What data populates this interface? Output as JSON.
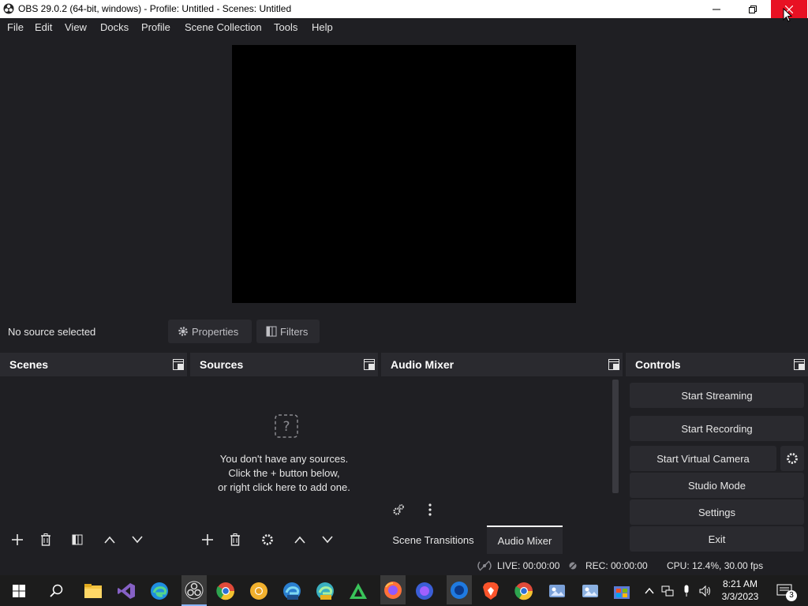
{
  "window": {
    "title": "OBS 29.0.2 (64-bit, windows) - Profile: Untitled - Scenes: Untitled",
    "minimize_icon": "minimize-icon",
    "restore_icon": "restore-icon",
    "close_icon": "close-icon"
  },
  "menu": [
    "File",
    "Edit",
    "View",
    "Docks",
    "Profile",
    "Scene Collection",
    "Tools",
    "Help"
  ],
  "source_toolbar": {
    "no_source": "No source selected",
    "properties": "Properties",
    "filters": "Filters"
  },
  "docks": {
    "scenes": {
      "title": "Scenes"
    },
    "sources": {
      "title": "Sources",
      "empty_line1": "You don't have any sources.",
      "empty_line2": "Click the + button below,",
      "empty_line3": "or right click here to add one."
    },
    "mixer": {
      "title": "Audio Mixer"
    },
    "controls": {
      "title": "Controls",
      "start_streaming": "Start Streaming",
      "start_recording": "Start Recording",
      "start_virtual_camera": "Start Virtual Camera",
      "studio_mode": "Studio Mode",
      "settings": "Settings",
      "exit": "Exit"
    }
  },
  "tabs": {
    "scene_transitions": "Scene Transitions",
    "audio_mixer": "Audio Mixer",
    "active": "audio_mixer"
  },
  "status": {
    "live": "LIVE: 00:00:00",
    "rec": "REC: 00:00:00",
    "cpu": "CPU: 12.4%, 30.00 fps"
  },
  "clock": {
    "time": "8:21 AM",
    "date": "3/3/2023"
  },
  "notifications_count": "3",
  "colors": {
    "background": "#1f1f23",
    "panel": "#2a2a2f",
    "close_red": "#e81123",
    "active_tab_border": "#ffffff"
  }
}
